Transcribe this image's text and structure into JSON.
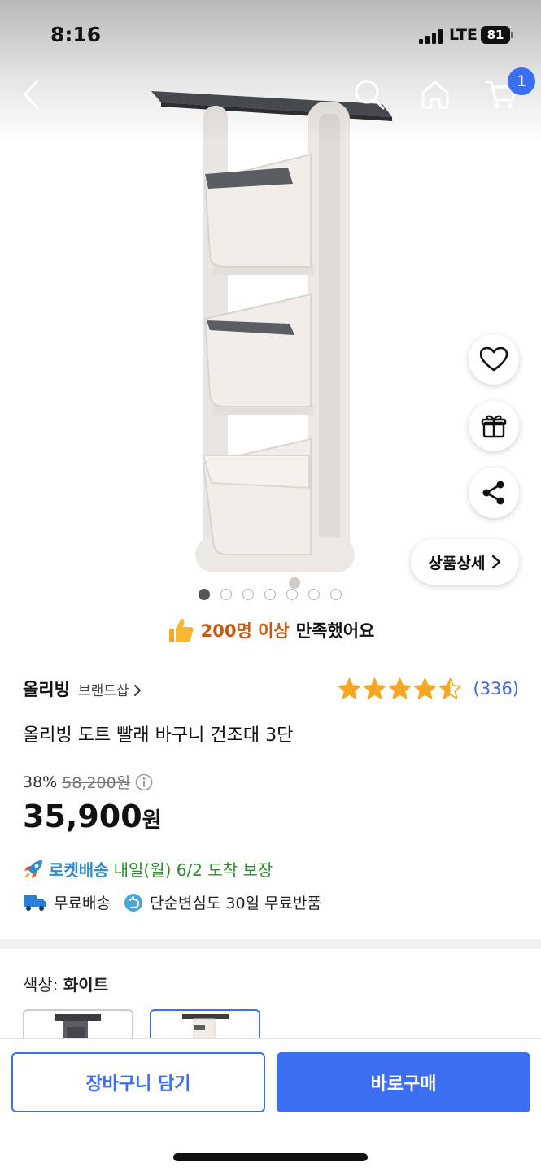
{
  "status": {
    "time": "8:16",
    "network": "LTE",
    "battery": "81"
  },
  "nav": {
    "cart_count": "1"
  },
  "icons": {
    "back": "chevron-left-icon",
    "search": "search-icon",
    "home": "home-icon",
    "cart": "cart-icon",
    "wish": "heart-icon",
    "gift": "gift-icon",
    "share": "share-icon"
  },
  "product_image": {
    "alt": "3-tier laundry basket rack",
    "carousel_count": 7,
    "carousel_active": 0
  },
  "detail_button": "상품상세",
  "satisfaction": {
    "highlight": "200명 이상",
    "text": "만족했어요"
  },
  "brand": {
    "name": "올리빙",
    "shop_link": "브랜드샵"
  },
  "rating": {
    "stars": 4.5,
    "count": "(336)"
  },
  "product_title": "올리빙 도트 빨래 바구니 건조대 3단",
  "price": {
    "discount": "38%",
    "original": "58,200원",
    "current": "35,900",
    "unit": "원"
  },
  "delivery": {
    "brand": "로켓배송",
    "eta": "내일(월) 6/2 도착 보장"
  },
  "benefits": [
    {
      "text": "무료배송"
    },
    {
      "text": "단순변심도 30일 무료반품"
    }
  ],
  "option": {
    "label": "색상:",
    "selected": "화이트"
  },
  "colors": {
    "brand_blue": "#3b6ef0",
    "rocket_blue": "#2a8fcb",
    "rocket_green": "#2a8f2a",
    "star": "#f5a623",
    "highlight_orange": "#c85a12"
  },
  "actions": {
    "add_to_cart": "장바구니 담기",
    "buy_now": "바로구매"
  }
}
